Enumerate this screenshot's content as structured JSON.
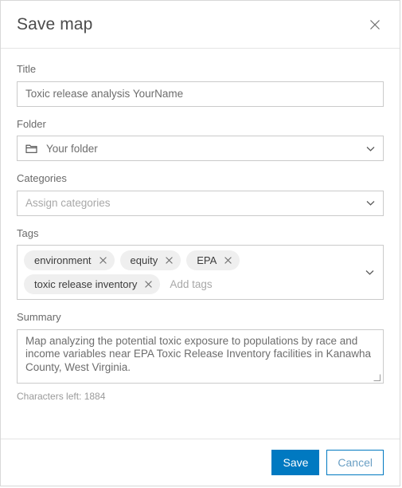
{
  "dialog": {
    "title": "Save map",
    "close_icon": "close-icon"
  },
  "form": {
    "title_field": {
      "label": "Title",
      "value": "Toxic release analysis YourName"
    },
    "folder_field": {
      "label": "Folder",
      "value": "Your folder",
      "icon": "folder-icon",
      "chevron": "chevron-down-icon"
    },
    "categories_field": {
      "label": "Categories",
      "placeholder": "Assign categories",
      "value": "",
      "chevron": "chevron-down-icon"
    },
    "tags_field": {
      "label": "Tags",
      "tags": [
        "environment",
        "equity",
        "EPA",
        "toxic release inventory"
      ],
      "add_placeholder": "Add tags",
      "chevron": "chevron-down-icon",
      "remove_icon": "close-icon"
    },
    "summary_field": {
      "label": "Summary",
      "value": "Map analyzing the potential toxic exposure to populations by race and income variables near EPA Toxic Release Inventory facilities in Kanawha County, West Virginia.",
      "characters_left": "Characters left: 1884"
    }
  },
  "footer": {
    "save_label": "Save",
    "cancel_label": "Cancel"
  },
  "colors": {
    "accent": "#0079c1",
    "border": "#cacaca",
    "chip_bg": "#efefef",
    "text": "#6d6d6d",
    "placeholder": "#a8a8a8"
  }
}
